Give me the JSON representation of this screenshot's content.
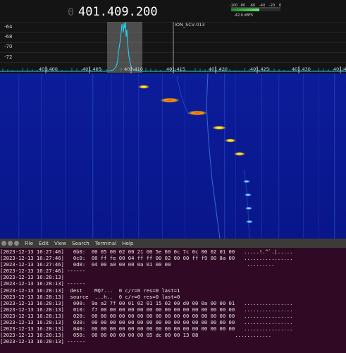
{
  "sdr": {
    "frequency_prefix": "0",
    "frequency": "401.409.200",
    "db_labels": [
      "-64",
      "-68",
      "-70",
      "-72"
    ],
    "freq_ticks": [
      "401.400",
      "401.405",
      "401.410",
      "401.415",
      "401.420",
      "401.425",
      "401.430",
      "401.43"
    ],
    "marker_label": "ION_SCV-013",
    "meter_scale": [
      "-100",
      "-80",
      "-60",
      "-40",
      "-20",
      "0"
    ],
    "meter_value": "-42.6 dBFS",
    "meter_level": 0.57,
    "colors": {
      "background": "#141414",
      "waterfall": "#0a1a8c",
      "trace": "#22d3ee",
      "signal_hot": "#ff4500",
      "signal_warm": "#ffd400"
    }
  },
  "terminal": {
    "menu": [
      "File",
      "Edit",
      "View",
      "Search",
      "Terminal",
      "Help"
    ],
    "lines": [
      "[2023-12-13 16:27:46]   0b0:  00 05 00 02 00 21 00 5e 60 0c 7c 0c 00 02 01 00   .....!.^`.|.....",
      "[2023-12-13 16:27:46]   0c0:  00 ff fe 00 04 ff ff 00 02 00 00 ff f9 00 8a 00   ................",
      "[2023-12-13 16:27:46]   0d0:  04 00 a0 00 00 0a 01 00 00                         .........",
      "[2023-12-13 16:27:46] ------",
      "[2023-12-13 16:28:13]",
      "[2023-12-13 16:28:13] ------",
      "[2023-12-13 16:28:13]  dest    MQ?...  0 c/r=0 res=0 last=1",
      "[2023-12-13 16:28:13]  source  ...h..  0 c/r=0 res=0 last=0",
      "[2023-12-13 16:28:13]   000:  9a a2 7f 00 01 02 01 15 02 00 d0 00 0a 00 00 01   ................",
      "[2023-12-13 16:28:13]   010:  f7 00 00 00 00 00 00 00 00 00 00 00 00 00 00 00   ................",
      "[2023-12-13 16:28:13]   020:  00 00 00 00 00 00 00 00 00 00 00 00 00 00 00 00   ................",
      "[2023-12-13 16:28:13]   030:  00 00 00 00 00 00 00 00 00 00 00 00 00 00 00 00   ................",
      "[2023-12-13 16:28:13]   040:  00 00 00 00 00 00 00 00 00 00 00 00 00 00 00 00   ................",
      "[2023-12-13 16:28:13]   050:  00 00 00 00 00 00 05 dc 00 00 13 88            ............",
      "[2023-12-13 16:28:13] ------"
    ]
  }
}
